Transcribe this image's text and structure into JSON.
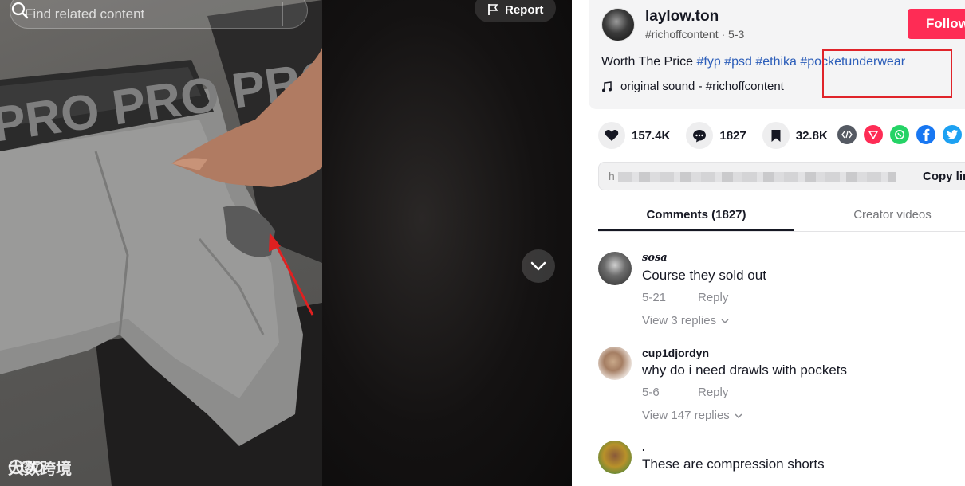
{
  "search": {
    "placeholder": "Find related content"
  },
  "video": {
    "report_label": "Report",
    "waistband_text": "PRO PRO PRO",
    "watermark_text": "大数跨境"
  },
  "author": {
    "username": "laylow.ton",
    "handle": "#richoffcontent",
    "date": "5-3",
    "follow_label": "Follow"
  },
  "caption": {
    "text": "Worth The Price",
    "hashtags": [
      "#fyp",
      "#psd",
      "#ethika",
      "#pocketunderwear"
    ],
    "music": "original sound - #richoffcontent"
  },
  "actions": {
    "likes": "157.4K",
    "comments": "1827",
    "saves": "32.8K"
  },
  "share": {
    "icons": [
      "embed-icon",
      "send-icon",
      "whatsapp-icon",
      "facebook-icon",
      "twitter-icon"
    ],
    "colors": {
      "embed": "#555a63",
      "send": "#fe2c55",
      "whatsapp": "#25d366",
      "facebook": "#1877f2",
      "twitter": "#1da1f2"
    }
  },
  "link": {
    "prefix": "h",
    "suffix": ".",
    "copy_label": "Copy lin"
  },
  "tabs": [
    {
      "label": "Comments (1827)",
      "active": true
    },
    {
      "label": "Creator videos",
      "active": false
    }
  ],
  "comments": [
    {
      "user": "sosa",
      "text": "Course they sold out",
      "date": "5-21",
      "reply_label": "Reply",
      "replies_label": "View 3 replies"
    },
    {
      "user": "cup1djordyn",
      "text": "why do i need drawls with pockets",
      "date": "5-6",
      "reply_label": "Reply",
      "replies_label": "View 147 replies"
    },
    {
      "user": ".",
      "text": "These are compression shorts",
      "date": "",
      "reply_label": "",
      "replies_label": ""
    }
  ],
  "colors": {
    "accent": "#fe2c55",
    "hashtag": "#2b5db9",
    "highlight": "#e0242a"
  }
}
